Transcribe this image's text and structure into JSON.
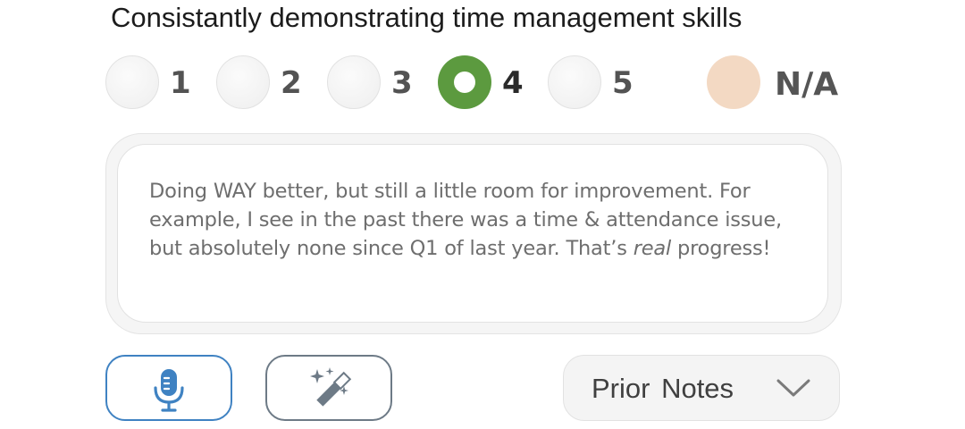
{
  "question": {
    "title": "Consistantly demonstrating time management skills"
  },
  "rating": {
    "options": [
      {
        "label": "1",
        "selected": false
      },
      {
        "label": "2",
        "selected": false
      },
      {
        "label": "3",
        "selected": false
      },
      {
        "label": "4",
        "selected": true
      },
      {
        "label": "5",
        "selected": false
      },
      {
        "label": "N/A",
        "selected": false
      }
    ],
    "selected_value": "4",
    "colors": {
      "selected": "#5c9a3f",
      "na": "#f3d9c3",
      "unselected": "#f2f2f2"
    }
  },
  "notes": {
    "text_part1": "Doing WAY better, but still a little room for improvement. For example, I see in the past there was a time & attendance issue, but absolutely none since Q1 of last year. That’s ",
    "text_emphasis": "real",
    "text_part2": " progress!"
  },
  "actions": {
    "mic_icon": "microphone-icon",
    "magic_icon": "magic-wand-icon",
    "mic_color": "#3f82c2",
    "magic_color": "#6d7a86"
  },
  "prior_notes": {
    "label": "Prior Notes",
    "icon": "chevron-down-icon"
  }
}
